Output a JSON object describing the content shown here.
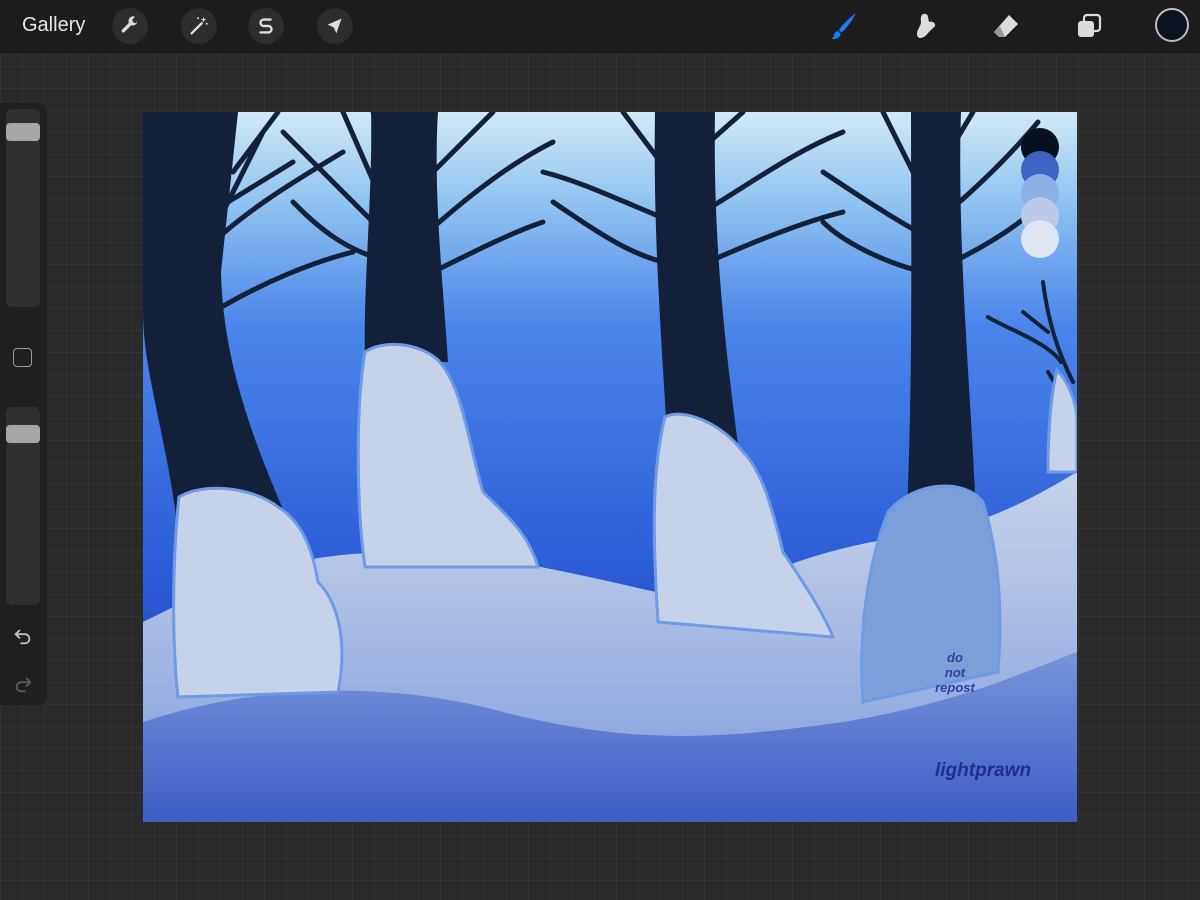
{
  "toolbar": {
    "gallery_label": "Gallery",
    "left_tools": [
      "wrench-icon",
      "magic-wand-icon",
      "selection-s-icon",
      "arrow-transform-icon"
    ],
    "right_tools": [
      "brush-icon",
      "smudge-icon",
      "eraser-icon",
      "layers-icon"
    ],
    "active_tool": "brush",
    "active_color": "#0b1220",
    "accent_color": "#1e7cf0"
  },
  "sidebar": {
    "brush_size_level": 0.92,
    "opacity_level": 0.9,
    "undo_icon": "undo-icon",
    "redo_icon": "redo-icon"
  },
  "canvas": {
    "watermark_lines": [
      "do",
      "not",
      "repost"
    ],
    "signature": "lightprawn",
    "palette_colors": [
      "#07111f",
      "#3c65c6",
      "#8cb0e4",
      "#b9cbe8",
      "#dfe6f1"
    ]
  }
}
